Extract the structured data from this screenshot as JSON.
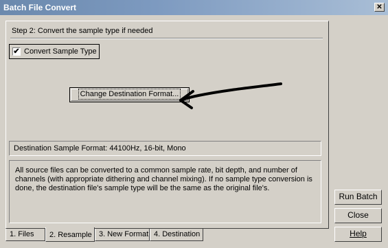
{
  "window": {
    "title": "Batch File Convert",
    "close_glyph": "✕"
  },
  "step": {
    "label": "Step 2:  Convert the sample type if needed"
  },
  "convert_sample_type": {
    "label": "Convert Sample Type",
    "checked": true,
    "check_glyph": "✔"
  },
  "change_button": {
    "label": "Change Destination Format..."
  },
  "destination_format": {
    "text": "Destination Sample Format: 44100Hz, 16-bit, Mono"
  },
  "info": {
    "text": "All source files can be converted to a common sample rate, bit depth, and number of channels (with appropriate dithering and channel mixing).  If no sample type conversion is done, the destination file's sample type will be the same as the original file's."
  },
  "tabs": [
    {
      "label": "1. Files",
      "active": false
    },
    {
      "label": "2. Resample",
      "active": true
    },
    {
      "label": "3. New Format",
      "active": false
    },
    {
      "label": "4. Destination",
      "active": false
    }
  ],
  "buttons": {
    "run_batch": "Run Batch",
    "close": "Close",
    "help": "Help"
  },
  "annotation": {
    "arrow_color": "#000000"
  },
  "colors": {
    "titlebar_start": "#6b89ad",
    "titlebar_end": "#a9bed6",
    "face": "#d4d0c8"
  }
}
